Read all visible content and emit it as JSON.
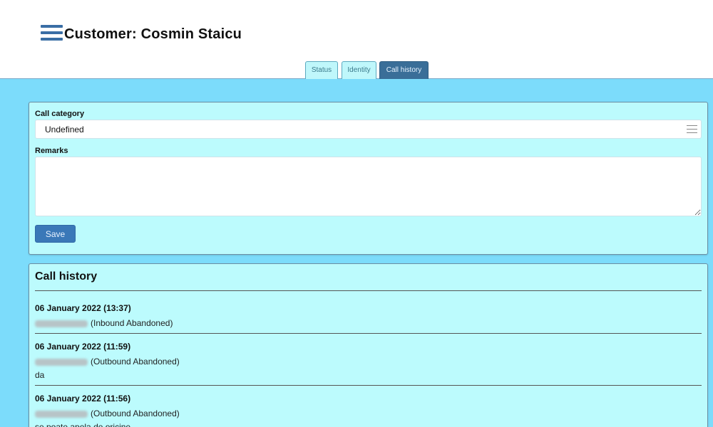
{
  "header": {
    "title": "Customer: Cosmin Staicu",
    "menu_icon": "hamburger-menu-icon"
  },
  "tabs": [
    {
      "label": "Status",
      "active": false
    },
    {
      "label": "Identity",
      "active": false
    },
    {
      "label": "Call history",
      "active": true
    }
  ],
  "form": {
    "call_category_label": "Call category",
    "call_category_value": "Undefined",
    "remarks_label": "Remarks",
    "remarks_value": "",
    "save_label": "Save"
  },
  "history": {
    "title": "Call history",
    "entries": [
      {
        "date": "06 January 2022 (13:37)",
        "type": "(Inbound Abandoned)",
        "remark": ""
      },
      {
        "date": "06 January 2022 (11:59)",
        "type": "(Outbound Abandoned)",
        "remark": "da"
      },
      {
        "date": "06 January 2022 (11:56)",
        "type": "(Outbound Abandoned)",
        "remark": "se poate apela de oricine"
      }
    ]
  },
  "colors": {
    "background": "#7cdcfb",
    "panel": "#bcfbfd",
    "accent": "#3a78b8",
    "active_tab": "#3a6e98"
  }
}
